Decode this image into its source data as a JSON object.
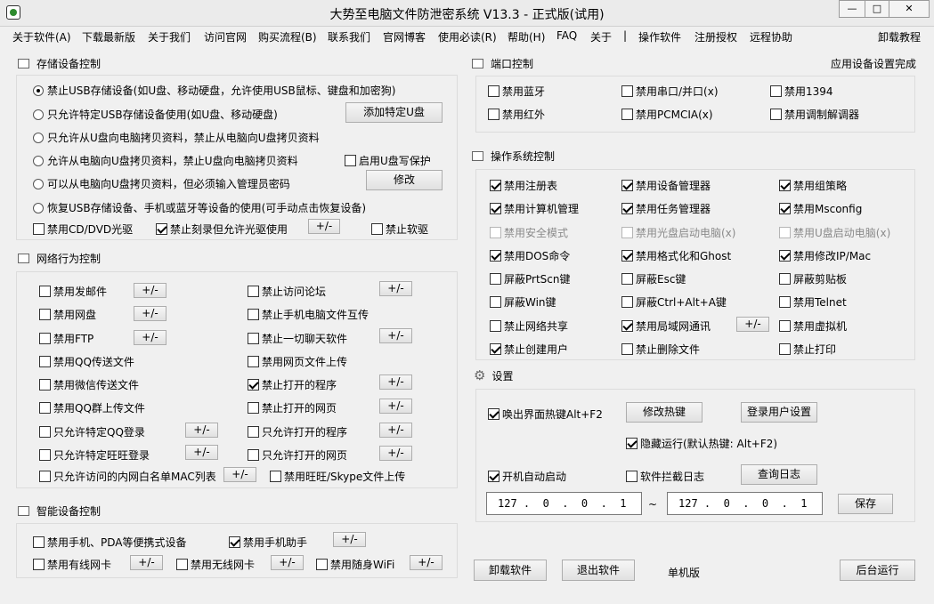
{
  "title": "大势至电脑文件防泄密系统 V13.3 - 正式版(试用)",
  "window_buttons": {
    "min": "—",
    "max": "□",
    "close": "✕"
  },
  "menu": [
    "关于软件(A)",
    "下载最新版",
    "关于我们",
    "访问官网",
    "购买流程(B)",
    "联系我们",
    "官网博客",
    "使用必读(R)",
    "帮助(H)",
    "FAQ",
    "关于",
    "|",
    "操作软件",
    "注册授权",
    "远程协助",
    "卸载教程"
  ],
  "storage": {
    "title": "存储设备控制",
    "r1": "禁止USB存储设备(如U盘、移动硬盘，允许使用USB鼠标、键盘和加密狗)",
    "r2": "只允许特定USB存储设备使用(如U盘、移动硬盘)",
    "r3": "只允许从U盘向电脑拷贝资料，禁止从电脑向U盘拷贝资料",
    "r4": "允许从电脑向U盘拷贝资料，禁止U盘向电脑拷贝资料",
    "r5": "可以从电脑向U盘拷贝资料，但必须输入管理员密码",
    "r6": "恢复USB存储设备、手机或蓝牙等设备的使用(可手动点击恢复设备)",
    "add_btn": "添加特定U盘",
    "modify_btn": "修改",
    "write_protect": "启用U盘写保护",
    "cd": "禁用CD/DVD光驱",
    "burn": "禁止刻录但允许光驱使用",
    "floppy": "禁止软驱",
    "pm": "+/-"
  },
  "network": {
    "title": "网络行为控制",
    "items": [
      "禁用发邮件",
      "禁止访问论坛",
      "禁用网盘",
      "禁止手机电脑文件互传",
      "禁用FTP",
      "禁止一切聊天软件",
      "禁用QQ传送文件",
      "禁用网页文件上传",
      "禁用微信传送文件",
      "禁止打开的程序",
      "禁用QQ群上传文件",
      "禁止打开的网页",
      "只允许特定QQ登录",
      "只允许打开的程序",
      "只允许特定旺旺登录",
      "只允许打开的网页",
      "只允许访问的内网白名单MAC列表",
      "禁用旺旺/Skype文件上传"
    ]
  },
  "smart": {
    "title": "智能设备控制",
    "items": [
      "禁用手机、PDA等便携式设备",
      "禁用手机助手",
      "禁用有线网卡",
      "禁用无线网卡",
      "禁用随身WiFi"
    ]
  },
  "port": {
    "title": "端口控制",
    "status": "应用设备设置完成",
    "items": [
      "禁用蓝牙",
      "禁用串口/并口(x)",
      "禁用1394",
      "禁用红外",
      "禁用PCMCIA(x)",
      "禁用调制解调器"
    ]
  },
  "os": {
    "title": "操作系统控制",
    "items": [
      "禁用注册表",
      "禁用设备管理器",
      "禁用组策略",
      "禁用计算机管理",
      "禁用任务管理器",
      "禁用Msconfig",
      "禁用安全模式",
      "禁用光盘启动电脑(x)",
      "禁用U盘启动电脑(x)",
      "禁用DOS命令",
      "禁用格式化和Ghost",
      "禁用修改IP/Mac",
      "屏蔽PrtScn键",
      "屏蔽Esc键",
      "屏蔽剪贴板",
      "屏蔽Win键",
      "屏蔽Ctrl+Alt+A键",
      "禁用Telnet",
      "禁止网络共享",
      "禁用局域网通讯",
      "禁用虚拟机",
      "禁止创建用户",
      "禁止删除文件",
      "禁止打印"
    ]
  },
  "settings": {
    "title": "设置",
    "hotkey": "唤出界面热键Alt+F2",
    "modify_hotkey": "修改热键",
    "login_settings": "登录用户设置",
    "hide_run": "隐藏运行(默认热键: Alt+F2)",
    "autostart": "开机自动启动",
    "log": "软件拦截日志",
    "view_log": "查询日志",
    "ip_from": "127 .  0  .  0  .  1",
    "ip_to": "127 .  0  .  0  .  1",
    "tilde": "~",
    "save": "保存"
  },
  "bottom": {
    "uninstall": "卸载软件",
    "exit": "退出软件",
    "edition": "单机版",
    "background": "后台运行"
  }
}
